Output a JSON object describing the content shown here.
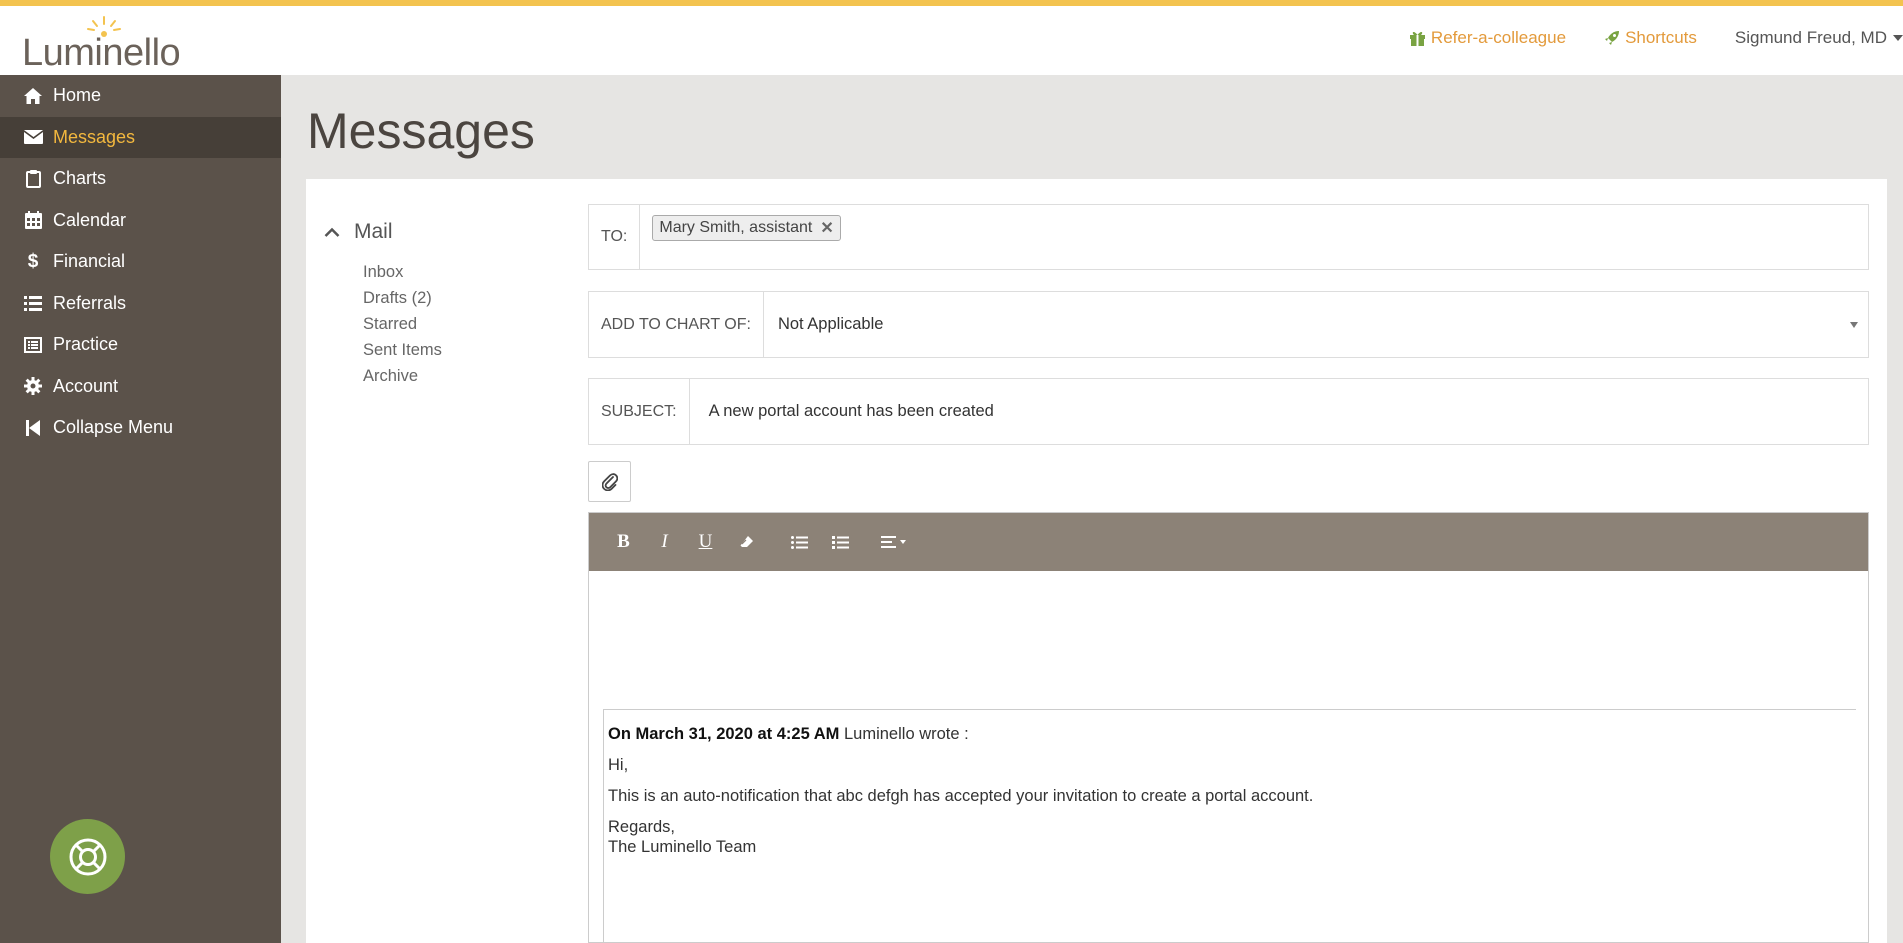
{
  "brand": {
    "name": "Luminello",
    "accent": "#f3c34f",
    "sidebar_bg": "#5b524a",
    "active_color": "#f3b83e",
    "link_color": "#e39a3b"
  },
  "header": {
    "refer_label": "Refer-a-colleague",
    "shortcuts_label": "Shortcuts",
    "user_name": "Sigmund Freud, MD"
  },
  "sidebar": {
    "items": [
      {
        "label": "Home",
        "icon": "home-icon"
      },
      {
        "label": "Messages",
        "icon": "envelope-icon",
        "active": true
      },
      {
        "label": "Charts",
        "icon": "clipboard-icon"
      },
      {
        "label": "Calendar",
        "icon": "calendar-icon"
      },
      {
        "label": "Financial",
        "icon": "dollar-icon"
      },
      {
        "label": "Referrals",
        "icon": "list-icon"
      },
      {
        "label": "Practice",
        "icon": "list-alt-icon"
      },
      {
        "label": "Account",
        "icon": "gear-icon"
      },
      {
        "label": "Collapse Menu",
        "icon": "step-backward-icon"
      }
    ]
  },
  "page": {
    "title": "Messages"
  },
  "mail": {
    "heading": "Mail",
    "folders": [
      "Inbox",
      "Drafts (2)",
      "Starred",
      "Sent Items",
      "Archive"
    ]
  },
  "compose": {
    "to_label": "TO:",
    "to_recipient": "Mary Smith, assistant",
    "chart_label": "ADD TO CHART OF:",
    "chart_value": "Not Applicable",
    "subject_label": "SUBJECT:",
    "subject_value": "A new portal account has been created"
  },
  "editor": {
    "toolbar": [
      "bold-icon",
      "italic-icon",
      "underline-icon",
      "eraser-icon",
      "bulleted-list-icon",
      "numbered-list-icon",
      "align-icon"
    ],
    "quote_header_bold": "On March 31, 2020 at 4:25 AM",
    "quote_header_rest": " Luminello wrote :",
    "greeting": "Hi,",
    "body": "This is an auto-notification that abc defgh has accepted your invitation to create a portal account.",
    "sign_off": "Regards,",
    "signature": "The Luminello Team"
  }
}
